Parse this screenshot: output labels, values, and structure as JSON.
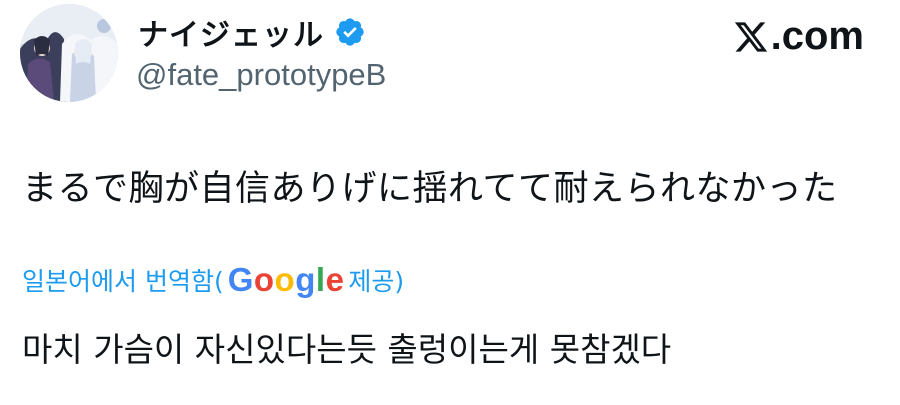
{
  "user": {
    "display_name": "ナイジェッル",
    "handle": "@fate_prototypeB",
    "verified": true
  },
  "site": {
    "name": ".com",
    "logo_icon": "x-logo-icon"
  },
  "tweet": {
    "text": "まるで胸が自信ありげに揺れてて耐えられなかった"
  },
  "translation": {
    "prefix": "일본어에서 번역함(",
    "provider": [
      "G",
      "o",
      "o",
      "g",
      "l",
      "e"
    ],
    "suffix": " 제공)",
    "text": "마치 가슴이 자신있다는듯 출렁이는게 못참겠다"
  },
  "colors": {
    "verified_badge": "#1d9bf0",
    "link": "#1d9bf0",
    "handle": "#536471"
  }
}
